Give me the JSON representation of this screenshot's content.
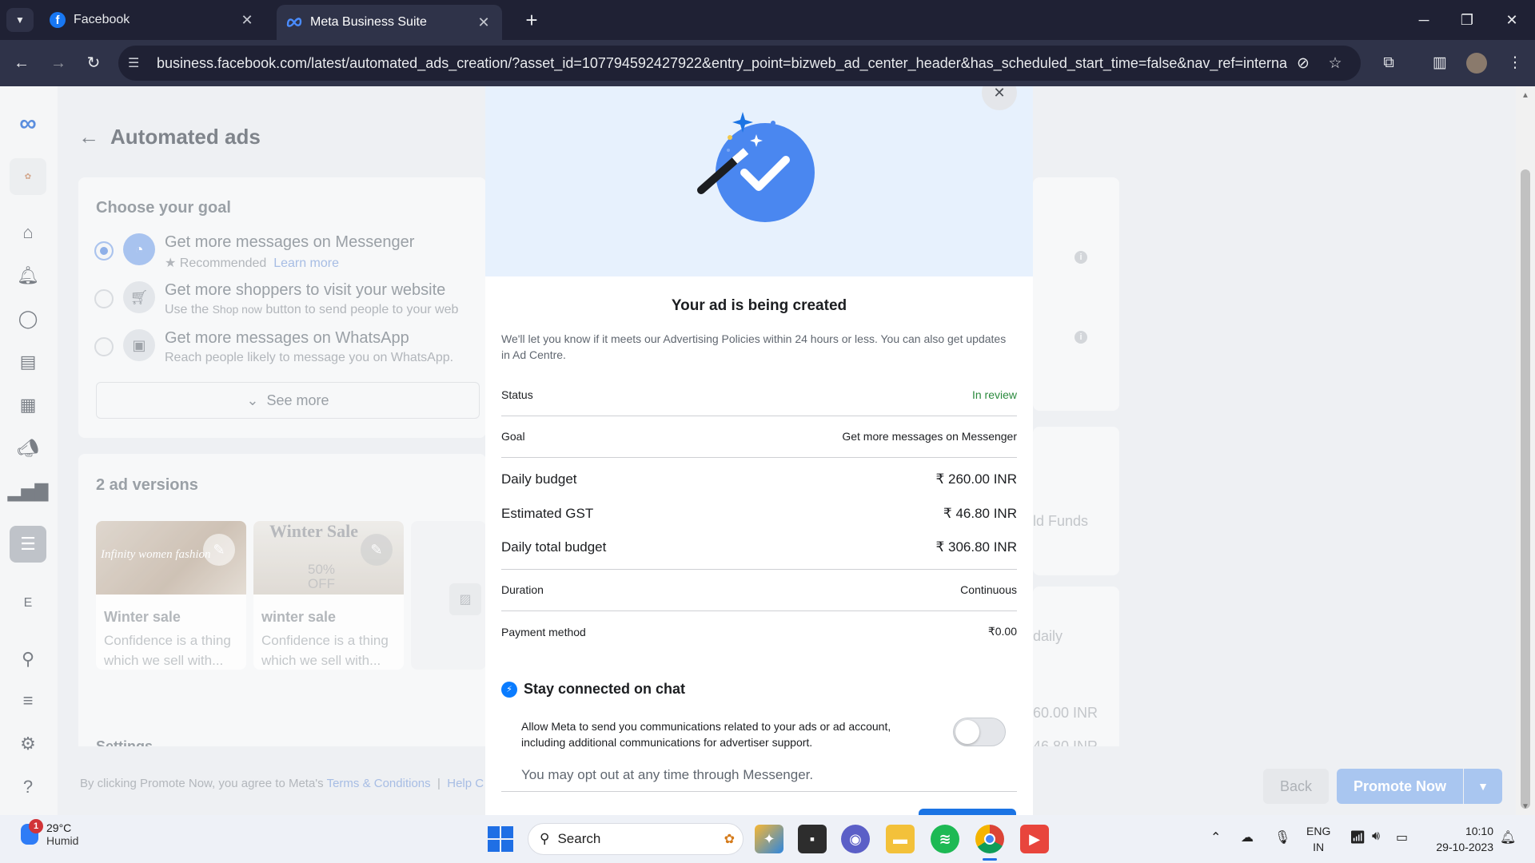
{
  "browser": {
    "tabs": [
      {
        "title": "Facebook",
        "icon": "facebook-icon"
      },
      {
        "title": "Meta Business Suite",
        "icon": "meta-icon"
      }
    ],
    "url": "business.facebook.com/latest/automated_ads_creation/?asset_id=107794592427922&entry_point=bizweb_ad_center_header&has_scheduled_start_time=false&nav_ref=internal_nav..."
  },
  "page": {
    "title": "Automated ads",
    "goal_section": {
      "title": "Choose your goal",
      "options": [
        {
          "title": "Get more messages on Messenger",
          "recommended": "Recommended",
          "learn_more": "Learn more"
        },
        {
          "title": "Get more shoppers to visit your website",
          "subtitle_pre": "Use the",
          "subtitle_btn": "Shop now",
          "subtitle_post": "button to send people to your web"
        },
        {
          "title": "Get more messages on WhatsApp",
          "subtitle": "Reach people likely to message you on WhatsApp."
        }
      ],
      "see_more": "See more"
    },
    "versions": {
      "title": "2 ad versions",
      "ads": [
        {
          "image_text": "Infinity women fashion",
          "name": "Winter sale",
          "desc_1": "Confidence is a thing",
          "desc_2": "which we sell with..."
        },
        {
          "image_title": "Winter Sale",
          "image_pct": "50%",
          "image_off": "OFF",
          "name": "winter sale",
          "desc_1": "Confidence is a thing",
          "desc_2": "which we sell with..."
        }
      ]
    },
    "settings_title": "Settings",
    "right_fragments": {
      "add_funds": "ld Funds",
      "daily": "daily",
      "amount1": "60.00 INR",
      "amount2": "46.80 INR"
    },
    "footer": {
      "text_pre": "By clicking Promote Now, you agree to Meta's",
      "terms": "Terms & Conditions",
      "sep": "|",
      "help": "Help C"
    },
    "buttons": {
      "back": "Back",
      "promote": "Promote Now"
    },
    "sidebar_letter": "E"
  },
  "modal": {
    "title": "Your ad is being created",
    "description": "We'll let you know if it meets our Advertising Policies within 24 hours or less. You can also get updates in Ad Centre.",
    "rows": [
      {
        "label": "Status",
        "value": "In review"
      },
      {
        "label": "Goal",
        "value": "Get more messages on Messenger"
      },
      {
        "label": "Daily budget",
        "value": "₹ 260.00 INR"
      },
      {
        "label": "Estimated GST",
        "value": "₹ 46.80 INR"
      },
      {
        "label": "Daily total budget",
        "value": "₹ 306.80 INR"
      },
      {
        "label": "Duration",
        "value": "Continuous"
      },
      {
        "label": "Payment method",
        "value": "₹0.00"
      }
    ],
    "chat": {
      "title": "Stay connected on chat",
      "allow_text": "Allow Meta to send you communications related to your ads or ad account, including additional communications for advertiser support.",
      "opt_out": "You may opt out at any time through Messenger.",
      "toggle_on": false
    }
  },
  "taskbar": {
    "weather": {
      "temp": "29°C",
      "condition": "Humid",
      "badge": "1"
    },
    "search_placeholder": "Search",
    "lang_1": "ENG",
    "lang_2": "IN",
    "time": "10:10",
    "date": "29-10-2023"
  },
  "colors": {
    "accent": "#1877f2",
    "status_green": "#2b8a3e",
    "hero_bg": "#e7f1fd"
  }
}
